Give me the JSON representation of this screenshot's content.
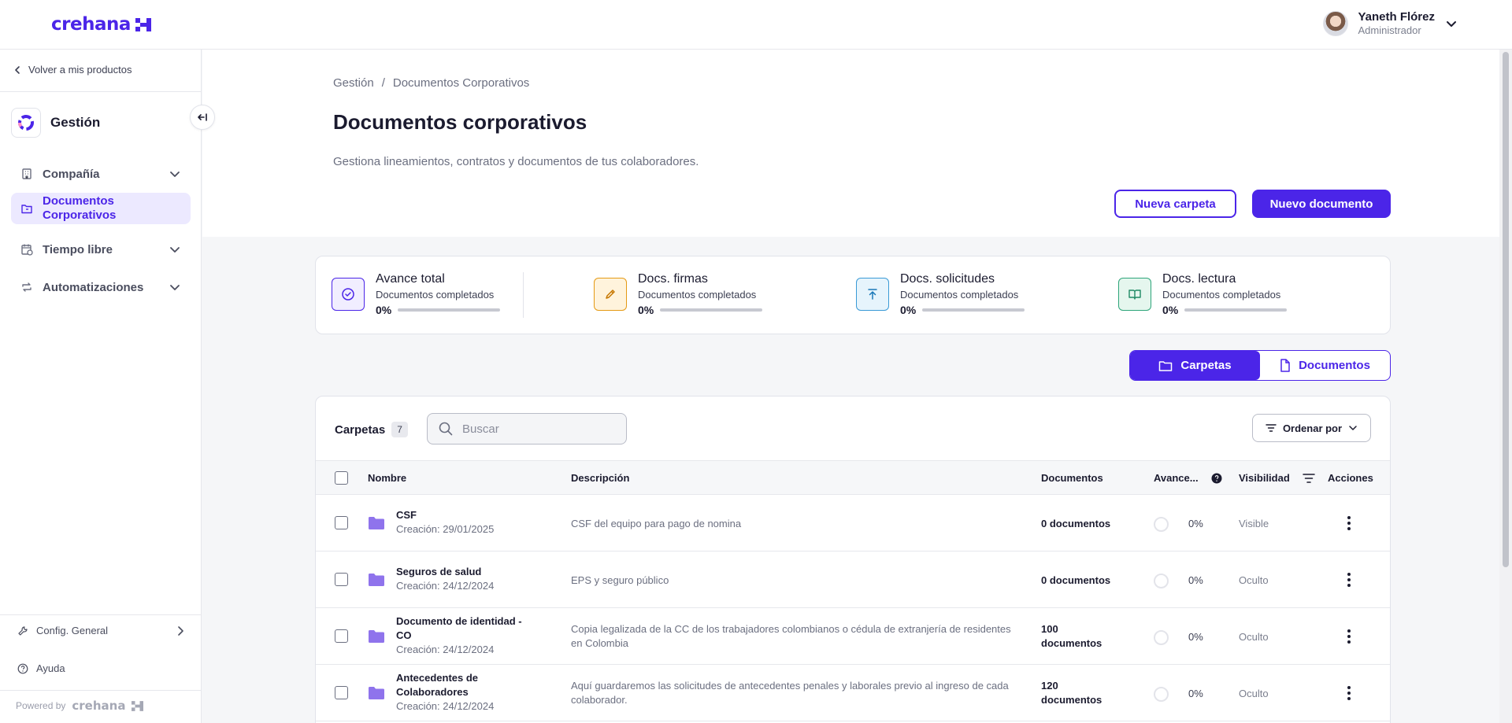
{
  "app": {
    "logo": "crehana"
  },
  "user": {
    "name": "Yaneth Flórez",
    "role": "Administrador"
  },
  "sidebar": {
    "back_label": "Volver a mis productos",
    "product": "Gestión",
    "items": [
      {
        "label": "Compañía"
      },
      {
        "label": "Documentos Corporativos"
      },
      {
        "label": "Tiempo libre"
      },
      {
        "label": "Automatizaciones"
      }
    ],
    "config_label": "Config. General",
    "help_label": "Ayuda",
    "powered_label": "Powered by",
    "powered_logo": "crehana"
  },
  "breadcrumb": {
    "root": "Gestión",
    "separator": "/",
    "current": "Documentos Corporativos"
  },
  "page": {
    "title": "Documentos corporativos",
    "subtitle": "Gestiona lineamientos, contratos y documentos de tus colaboradores.",
    "new_folder_label": "Nueva carpeta",
    "new_document_label": "Nuevo documento"
  },
  "stats": [
    {
      "title": "Avance total",
      "sub": "Documentos completados",
      "pct": "0%",
      "progress": 0,
      "color": "#4b25e8",
      "bg": "#f1eeff",
      "icon": "check-circle-icon"
    },
    {
      "title": "Docs. firmas",
      "sub": "Documentos completados",
      "pct": "0%",
      "progress": 0,
      "color": "#c77700",
      "bg": "#fff3dc",
      "icon": "pencil-icon"
    },
    {
      "title": "Docs. solicitudes",
      "sub": "Documentos completados",
      "pct": "0%",
      "progress": 0,
      "color": "#1a78b8",
      "bg": "#e6f4fc",
      "icon": "upload-icon"
    },
    {
      "title": "Docs. lectura",
      "sub": "Documentos completados",
      "pct": "0%",
      "progress": 0,
      "color": "#1f8a64",
      "bg": "#e5f6ee",
      "icon": "book-icon"
    }
  ],
  "view_toggle": {
    "folders_label": "Carpetas",
    "documents_label": "Documentos",
    "active": "Carpetas"
  },
  "table": {
    "title": "Carpetas",
    "count": "7",
    "search_placeholder": "Buscar",
    "sort_label": "Ordenar por",
    "columns": {
      "name": "Nombre",
      "description": "Descripción",
      "documents": "Documentos",
      "progress": "Avance...",
      "visibility": "Visibilidad",
      "actions": "Acciones"
    },
    "rows": [
      {
        "name": "CSF",
        "date": "Creación: 29/01/2025",
        "description": "CSF del equipo para pago de nomina",
        "documents": "0 documentos",
        "progress": "0%",
        "visibility": "Visible"
      },
      {
        "name": "Seguros de salud",
        "date": "Creación: 24/12/2024",
        "description": "EPS y seguro público",
        "documents": "0 documentos",
        "progress": "0%",
        "visibility": "Oculto"
      },
      {
        "name": "Documento de identidad - CO",
        "date": "Creación: 24/12/2024",
        "description": "Copia legalizada de la CC de los trabajadores colombianos o cédula de extranjería de residentes en Colombia",
        "documents": "100 documentos",
        "progress": "0%",
        "visibility": "Oculto"
      },
      {
        "name": "Antecedentes de Colaboradores",
        "date": "Creación: 24/12/2024",
        "description": "Aquí guardaremos las solicitudes de antecedentes penales y laborales previo al ingreso de cada colaborador.",
        "documents": "120 documentos",
        "progress": "0%",
        "visibility": "Oculto"
      }
    ]
  }
}
